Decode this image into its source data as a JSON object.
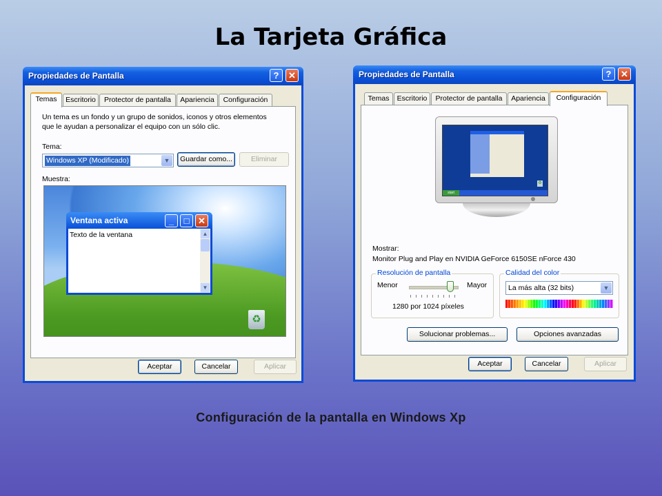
{
  "slide": {
    "title": "La Tarjeta Gráfica",
    "caption": "Configuración de la pantalla en Windows Xp"
  },
  "left_dialog": {
    "title": "Propiedades de Pantalla",
    "tabs": [
      "Temas",
      "Escritorio",
      "Protector de pantalla",
      "Apariencia",
      "Configuración"
    ],
    "active_tab": "Temas",
    "description_line1": "Un tema es un fondo y un grupo de sonidos, iconos y otros elementos",
    "description_line2": "que le ayudan a personalizar el equipo con un sólo clic.",
    "theme_label": "Tema:",
    "theme_value": "Windows XP (Modificado)",
    "save_as_label": "Guardar como...",
    "delete_label": "Eliminar",
    "sample_label": "Muestra:",
    "preview_window_title": "Ventana activa",
    "preview_window_text": "Texto de la ventana",
    "ok_label": "Aceptar",
    "cancel_label": "Cancelar",
    "apply_label": "Aplicar"
  },
  "right_dialog": {
    "title": "Propiedades de Pantalla",
    "tabs": [
      "Temas",
      "Escritorio",
      "Protector de pantalla",
      "Apariencia",
      "Configuración"
    ],
    "active_tab": "Configuración",
    "show_label": "Mostrar:",
    "monitor_text": "Monitor Plug and Play en NVIDIA GeForce 6150SE nForce 430",
    "resolution_group": "Resolución de pantalla",
    "less_label": "Menor",
    "more_label": "Mayor",
    "resolution_value": "1280 por 1024 píxeles",
    "color_group": "Calidad del color",
    "color_value": "La más alta (32 bits)",
    "troubleshoot_label": "Solucionar problemas...",
    "advanced_label": "Opciones avanzadas",
    "ok_label": "Aceptar",
    "cancel_label": "Cancelar",
    "apply_label": "Aplicar",
    "taskbar_start": "start"
  },
  "colors": {
    "xp_blue": "#0a4ad8",
    "dialog_bg": "#ece9d8",
    "tab_accent": "#f5a623",
    "desktop_blue": "#0f3c96"
  }
}
